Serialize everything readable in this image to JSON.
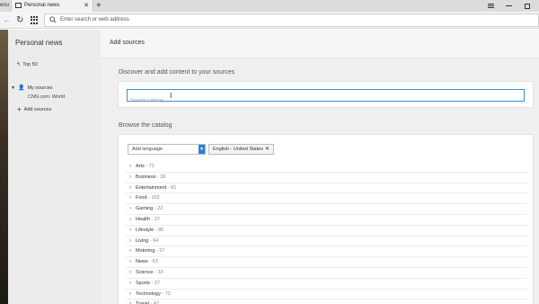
{
  "browser": {
    "menu_stub": "enu",
    "tab": {
      "title": "Personal news",
      "close": "✕"
    },
    "new_tab": "+",
    "address": {
      "placeholder": "Enter search or web address"
    }
  },
  "sidebar": {
    "title": "Personal news",
    "top50": "Top 50",
    "my_sources": "My sources",
    "source_item": "CNN.com: World",
    "add_sources": "Add sources"
  },
  "main": {
    "header_title": "Add sources",
    "discover_title": "Discover and add content to your sources",
    "search_placeholder": "Search catalog",
    "browse_title": "Browse the catalog",
    "add_language": "Add language",
    "language_chip": "English - United States",
    "chip_close": "✕",
    "categories": [
      {
        "name": "Arts",
        "count": "71"
      },
      {
        "name": "Business",
        "count": "36"
      },
      {
        "name": "Entertainment",
        "count": "81"
      },
      {
        "name": "Food",
        "count": "102"
      },
      {
        "name": "Gaming",
        "count": "22"
      },
      {
        "name": "Health",
        "count": "37"
      },
      {
        "name": "Lifestyle",
        "count": "86"
      },
      {
        "name": "Living",
        "count": "64"
      },
      {
        "name": "Motoring",
        "count": "27"
      },
      {
        "name": "News",
        "count": "63"
      },
      {
        "name": "Science",
        "count": "33"
      },
      {
        "name": "Sports",
        "count": "37"
      },
      {
        "name": "Technology",
        "count": "72"
      },
      {
        "name": "Travel",
        "count": "47"
      }
    ]
  },
  "colors": {
    "accent": "#3a8ee0",
    "sidebar_bg": "#ececec",
    "main_bg": "#efefef"
  }
}
